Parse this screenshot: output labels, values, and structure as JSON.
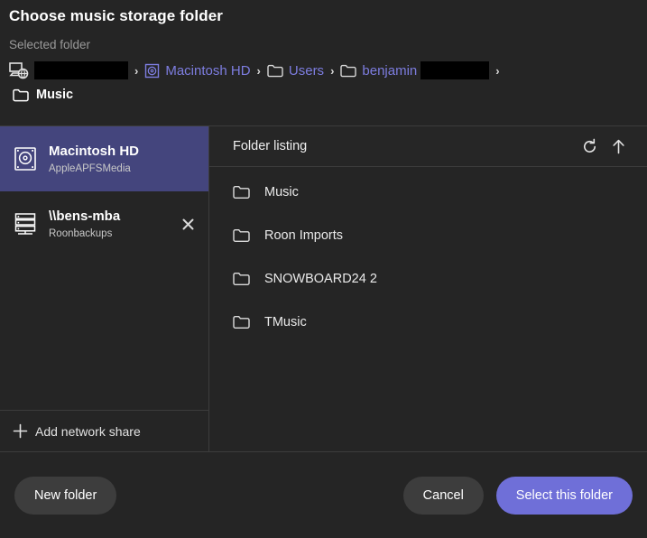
{
  "dialog": {
    "title": "Choose music storage folder",
    "selected_folder_label": "Selected folder",
    "current_folder": "Music"
  },
  "breadcrumb": {
    "items": [
      {
        "icon": "computer-network-icon",
        "label": "",
        "redacted": true,
        "redacted_width": 104
      },
      {
        "icon": "hard-drive-icon",
        "label": "Macintosh HD",
        "redacted": false
      },
      {
        "icon": "folder-icon",
        "label": "Users",
        "redacted": false
      },
      {
        "icon": "folder-icon",
        "label": "benjamin",
        "redacted": true,
        "redacted_width": 76
      }
    ],
    "separator": "›"
  },
  "sidebar": {
    "drives": [
      {
        "icon": "hard-drive-icon",
        "name": "Macintosh HD",
        "subtitle": "AppleAPFSMedia",
        "selected": true,
        "closable": false
      },
      {
        "icon": "network-server-icon",
        "name": "\\\\bens-mba",
        "subtitle": "Roonbackups",
        "selected": false,
        "closable": true
      }
    ],
    "add_network_share": {
      "icon": "plus-icon",
      "label": "Add network share"
    }
  },
  "listing": {
    "header_title": "Folder listing",
    "refresh_icon": "refresh-icon",
    "up_icon": "arrow-up-icon",
    "folders": [
      {
        "icon": "folder-icon",
        "name": "Music"
      },
      {
        "icon": "folder-icon",
        "name": "Roon Imports"
      },
      {
        "icon": "folder-icon",
        "name": "SNOWBOARD24 2"
      },
      {
        "icon": "folder-icon",
        "name": "TMusic"
      }
    ]
  },
  "footer": {
    "new_folder_label": "New folder",
    "cancel_label": "Cancel",
    "select_label": "Select this folder"
  },
  "colors": {
    "background": "#252525",
    "accent": "#6f6fd8",
    "selection": "#44457d",
    "link": "#7d7de0",
    "border": "#3c3c3c",
    "secondary_button": "#3d3d3d",
    "muted_text": "#9a9a9a"
  }
}
